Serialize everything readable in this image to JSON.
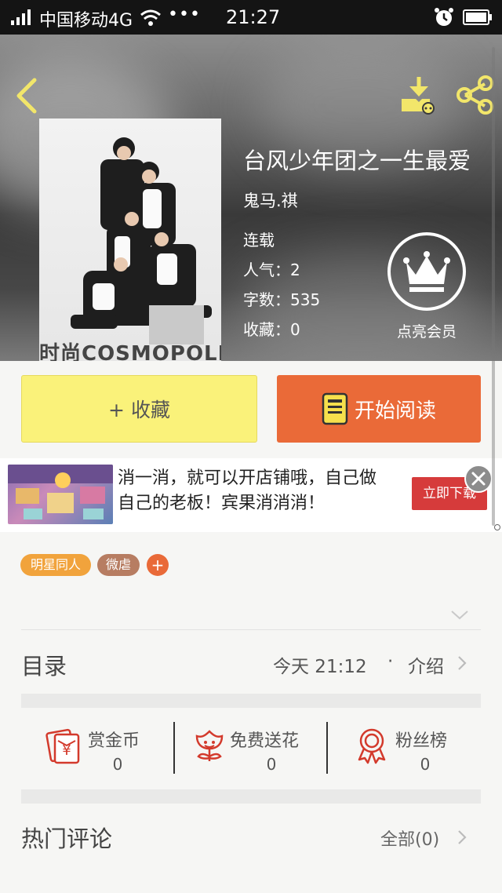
{
  "status_bar": {
    "carrier": "中国移动4G",
    "dots": "•••",
    "time": "21:27"
  },
  "book": {
    "title": "台风少年团之一生最爱",
    "author": "鬼马.祺",
    "status": "连载",
    "popularity": "人气：2",
    "words": "字数：535",
    "favorites": "收藏：0",
    "cover_text": "时尚COSMOPOLITAN"
  },
  "vip": {
    "label": "点亮会员"
  },
  "buttons": {
    "favorite": "+ 收藏",
    "read": "开始阅读"
  },
  "ad": {
    "text": "消一消，就可以开店铺哦，自己做自己的老板！宾果消消消！",
    "download": "立即下载"
  },
  "tags": {
    "items": [
      "明星同人",
      "微虐"
    ],
    "add": "+"
  },
  "toc": {
    "label": "目录",
    "update": "今天 21:12",
    "dot": "·",
    "intro": "介绍"
  },
  "actions": {
    "items": [
      {
        "label": "赏金币",
        "count": "0",
        "icon": "gold-coin-icon"
      },
      {
        "label": "免费送花",
        "count": "0",
        "icon": "flower-icon"
      },
      {
        "label": "粉丝榜",
        "count": "0",
        "icon": "ribbon-award-icon"
      }
    ]
  },
  "comments": {
    "label": "热门评论",
    "all": "全部(0)"
  },
  "colors": {
    "accent": "#ea6a38",
    "favorite_bg": "#faf27a",
    "icon_yellow": "#f2e66a",
    "icon_red": "#d33a2c",
    "tag_orange": "#f1a33c",
    "tag_brown": "#b77d62"
  }
}
